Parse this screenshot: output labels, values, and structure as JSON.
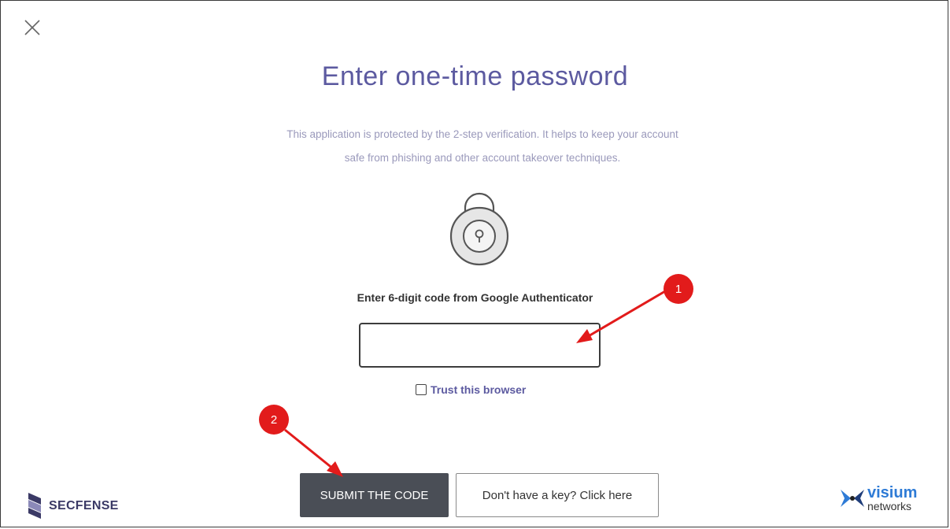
{
  "dialog": {
    "title": "Enter one-time password",
    "description_line1": "This application is protected by the 2-step verification. It helps to keep your account",
    "description_line2": "safe from phishing and other account takeover techniques.",
    "icons": {
      "close": "close-icon",
      "lock": "lock-icon"
    }
  },
  "code_field": {
    "label": "Enter 6-digit code from Google Authenticator",
    "value": "",
    "placeholder": ""
  },
  "trust": {
    "label": "Trust this browser",
    "checked": false
  },
  "buttons": {
    "submit": "SUBMIT THE CODE",
    "no_key": "Don't have a key? Click here"
  },
  "footer": {
    "left_logo_text": "SECFENSE",
    "right_logo_line1": "visium",
    "right_logo_line2": "networks"
  },
  "annotations": {
    "step1": "1",
    "step2": "2",
    "color": "#e21b1b"
  },
  "colors": {
    "title": "#5c5aa0",
    "submit_button": "#4a4e56",
    "visium_blue": "#2e7bd6"
  }
}
